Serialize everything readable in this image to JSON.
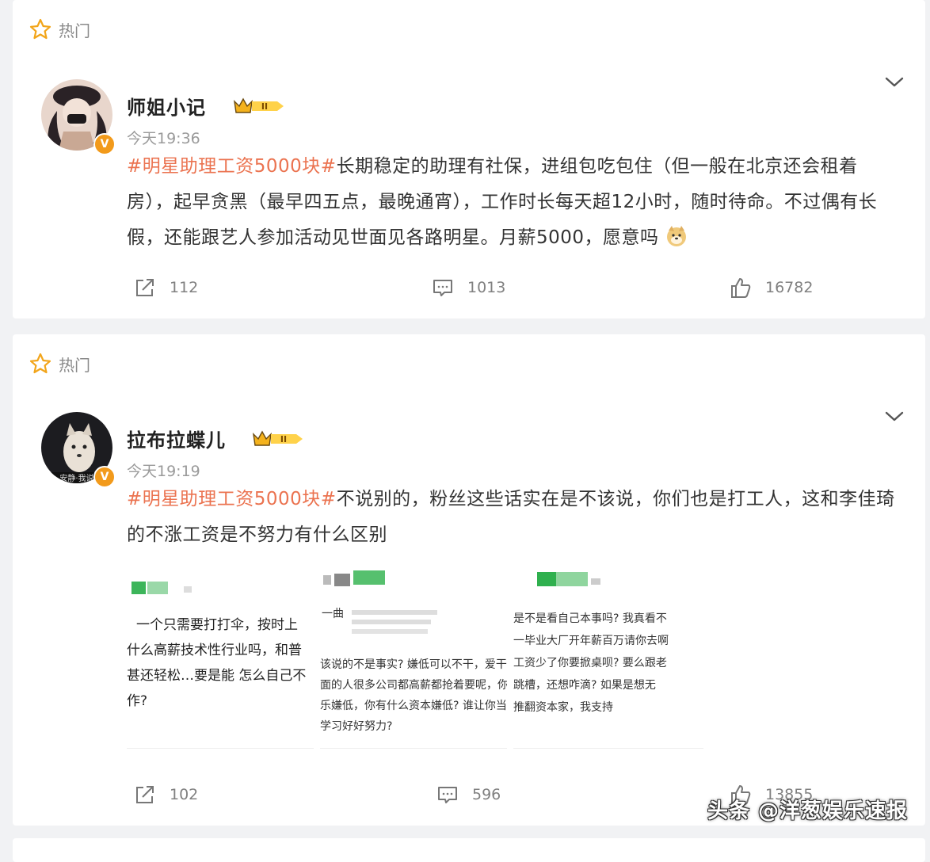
{
  "posts": [
    {
      "hot_label": "热门",
      "author": "师姐小记",
      "badge_level": "II",
      "verified_mark": "V",
      "time": "今天19:36",
      "hashtag": "#明星助理工资5000块#",
      "text": "长期稳定的助理有社保，进组包吃包住（但一般在北京还会租着房），起早贪黑（最早四五点，最晚通宵），工作时长每天超12小时，随时待命。不过偶有长假，还能跟艺人参加活动见世面见各路明星。月薪5000，愿意吗",
      "emoji": "doge-emoji",
      "reposts": "112",
      "comments": "1013",
      "likes": "16782"
    },
    {
      "hot_label": "热门",
      "author": "拉布拉蝶儿",
      "badge_level": "II",
      "verified_mark": "V",
      "avatar_caption": "安静·我说",
      "time": "今天19:19",
      "hashtag": "#明星助理工资5000块#",
      "text": "不说别的，粉丝这些话实在是不该说，你们也是打工人，这和李佳琦的不涨工资是不努力有什么区别",
      "images": [
        {
          "lines": [
            "一个只需要打打伞，按时上",
            "什么高薪技术性行业吗，和普",
            "甚还轻松…要是能 怎么自己不",
            "作?"
          ]
        },
        {
          "header": "一曲",
          "lines": [
            "该说的不是事实? 嫌低可以不干，爱干",
            "面的人很多公司都高薪都抢着要呢，你",
            "乐嫌低，你有什么资本嫌低? 谁让你当",
            "学习好好努力?"
          ]
        },
        {
          "lines": [
            "是不是看自己本事吗? 我真看不",
            "一毕业大厂开年薪百万请你去啊",
            "工资少了你要掀桌呗? 要么跟老",
            "跳槽，还想咋滴? 如果是想无",
            "推翻资本家，我支持"
          ]
        }
      ],
      "reposts": "102",
      "comments": "596",
      "likes": "13855"
    }
  ],
  "watermark": "头条 @洋葱娱乐速报",
  "colors": {
    "hashtag": "#eb7350",
    "badge": "#f29a1b",
    "bg": "#f1f2f4"
  }
}
